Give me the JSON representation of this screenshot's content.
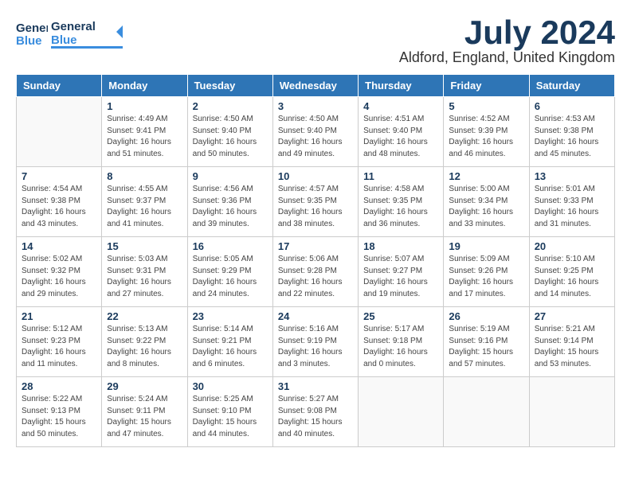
{
  "header": {
    "logo_general": "General",
    "logo_blue": "Blue",
    "month_title": "July 2024",
    "location": "Aldford, England, United Kingdom"
  },
  "days_of_week": [
    "Sunday",
    "Monday",
    "Tuesday",
    "Wednesday",
    "Thursday",
    "Friday",
    "Saturday"
  ],
  "weeks": [
    [
      {
        "day": "",
        "info": ""
      },
      {
        "day": "1",
        "info": "Sunrise: 4:49 AM\nSunset: 9:41 PM\nDaylight: 16 hours\nand 51 minutes."
      },
      {
        "day": "2",
        "info": "Sunrise: 4:50 AM\nSunset: 9:40 PM\nDaylight: 16 hours\nand 50 minutes."
      },
      {
        "day": "3",
        "info": "Sunrise: 4:50 AM\nSunset: 9:40 PM\nDaylight: 16 hours\nand 49 minutes."
      },
      {
        "day": "4",
        "info": "Sunrise: 4:51 AM\nSunset: 9:40 PM\nDaylight: 16 hours\nand 48 minutes."
      },
      {
        "day": "5",
        "info": "Sunrise: 4:52 AM\nSunset: 9:39 PM\nDaylight: 16 hours\nand 46 minutes."
      },
      {
        "day": "6",
        "info": "Sunrise: 4:53 AM\nSunset: 9:38 PM\nDaylight: 16 hours\nand 45 minutes."
      }
    ],
    [
      {
        "day": "7",
        "info": "Sunrise: 4:54 AM\nSunset: 9:38 PM\nDaylight: 16 hours\nand 43 minutes."
      },
      {
        "day": "8",
        "info": "Sunrise: 4:55 AM\nSunset: 9:37 PM\nDaylight: 16 hours\nand 41 minutes."
      },
      {
        "day": "9",
        "info": "Sunrise: 4:56 AM\nSunset: 9:36 PM\nDaylight: 16 hours\nand 39 minutes."
      },
      {
        "day": "10",
        "info": "Sunrise: 4:57 AM\nSunset: 9:35 PM\nDaylight: 16 hours\nand 38 minutes."
      },
      {
        "day": "11",
        "info": "Sunrise: 4:58 AM\nSunset: 9:35 PM\nDaylight: 16 hours\nand 36 minutes."
      },
      {
        "day": "12",
        "info": "Sunrise: 5:00 AM\nSunset: 9:34 PM\nDaylight: 16 hours\nand 33 minutes."
      },
      {
        "day": "13",
        "info": "Sunrise: 5:01 AM\nSunset: 9:33 PM\nDaylight: 16 hours\nand 31 minutes."
      }
    ],
    [
      {
        "day": "14",
        "info": "Sunrise: 5:02 AM\nSunset: 9:32 PM\nDaylight: 16 hours\nand 29 minutes."
      },
      {
        "day": "15",
        "info": "Sunrise: 5:03 AM\nSunset: 9:31 PM\nDaylight: 16 hours\nand 27 minutes."
      },
      {
        "day": "16",
        "info": "Sunrise: 5:05 AM\nSunset: 9:29 PM\nDaylight: 16 hours\nand 24 minutes."
      },
      {
        "day": "17",
        "info": "Sunrise: 5:06 AM\nSunset: 9:28 PM\nDaylight: 16 hours\nand 22 minutes."
      },
      {
        "day": "18",
        "info": "Sunrise: 5:07 AM\nSunset: 9:27 PM\nDaylight: 16 hours\nand 19 minutes."
      },
      {
        "day": "19",
        "info": "Sunrise: 5:09 AM\nSunset: 9:26 PM\nDaylight: 16 hours\nand 17 minutes."
      },
      {
        "day": "20",
        "info": "Sunrise: 5:10 AM\nSunset: 9:25 PM\nDaylight: 16 hours\nand 14 minutes."
      }
    ],
    [
      {
        "day": "21",
        "info": "Sunrise: 5:12 AM\nSunset: 9:23 PM\nDaylight: 16 hours\nand 11 minutes."
      },
      {
        "day": "22",
        "info": "Sunrise: 5:13 AM\nSunset: 9:22 PM\nDaylight: 16 hours\nand 8 minutes."
      },
      {
        "day": "23",
        "info": "Sunrise: 5:14 AM\nSunset: 9:21 PM\nDaylight: 16 hours\nand 6 minutes."
      },
      {
        "day": "24",
        "info": "Sunrise: 5:16 AM\nSunset: 9:19 PM\nDaylight: 16 hours\nand 3 minutes."
      },
      {
        "day": "25",
        "info": "Sunrise: 5:17 AM\nSunset: 9:18 PM\nDaylight: 16 hours\nand 0 minutes."
      },
      {
        "day": "26",
        "info": "Sunrise: 5:19 AM\nSunset: 9:16 PM\nDaylight: 15 hours\nand 57 minutes."
      },
      {
        "day": "27",
        "info": "Sunrise: 5:21 AM\nSunset: 9:14 PM\nDaylight: 15 hours\nand 53 minutes."
      }
    ],
    [
      {
        "day": "28",
        "info": "Sunrise: 5:22 AM\nSunset: 9:13 PM\nDaylight: 15 hours\nand 50 minutes."
      },
      {
        "day": "29",
        "info": "Sunrise: 5:24 AM\nSunset: 9:11 PM\nDaylight: 15 hours\nand 47 minutes."
      },
      {
        "day": "30",
        "info": "Sunrise: 5:25 AM\nSunset: 9:10 PM\nDaylight: 15 hours\nand 44 minutes."
      },
      {
        "day": "31",
        "info": "Sunrise: 5:27 AM\nSunset: 9:08 PM\nDaylight: 15 hours\nand 40 minutes."
      },
      {
        "day": "",
        "info": ""
      },
      {
        "day": "",
        "info": ""
      },
      {
        "day": "",
        "info": ""
      }
    ]
  ]
}
